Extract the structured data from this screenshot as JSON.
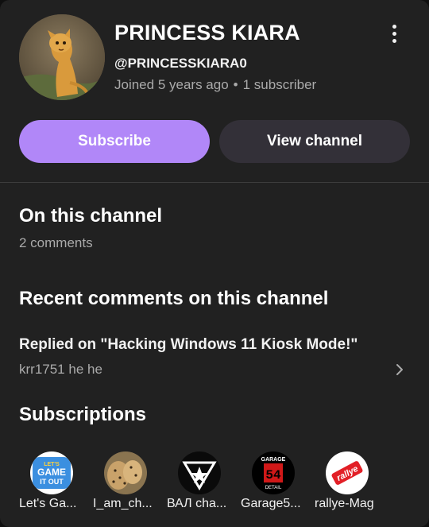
{
  "channel": {
    "name": "PRINCESS KIARA",
    "handle": "@PRINCESSKIARA0",
    "joined": "Joined 5 years ago",
    "separator": "•",
    "subscribers": "1 subscriber"
  },
  "buttons": {
    "subscribe": "Subscribe",
    "view_channel": "View channel"
  },
  "on_channel": {
    "heading": "On this channel",
    "count": "2 comments"
  },
  "recent": {
    "heading": "Recent comments on this channel",
    "comment_title": "Replied on \"Hacking Windows 11 Kiosk Mode!\"",
    "comment_text": "krr1751 he he"
  },
  "subscriptions": {
    "heading": "Subscriptions",
    "items": [
      {
        "label": "Let's Ga...",
        "logo_text": [
          "LET'S",
          "GAME",
          "IT OUT"
        ]
      },
      {
        "label": "I_am_ch..."
      },
      {
        "label": "ВАЛ cha..."
      },
      {
        "label": "Garage5...",
        "logo_text": [
          "GARAGE",
          "54",
          "DETAIL"
        ]
      },
      {
        "label": "rallye-Mag",
        "logo_text": "rallye"
      }
    ]
  },
  "colors": {
    "card_bg": "#212121",
    "subscribe_bg": "#b187f8",
    "view_channel_bg": "#333038",
    "secondary_text": "#aaaaaa"
  }
}
